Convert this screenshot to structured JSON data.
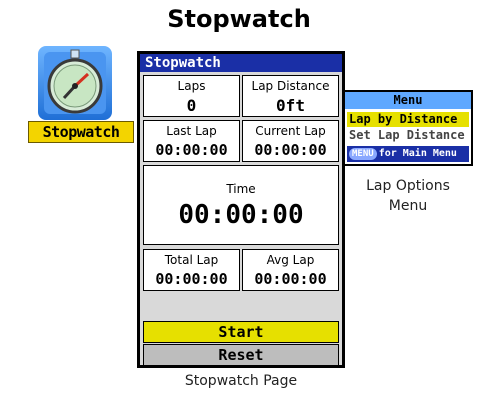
{
  "page_title": "Stopwatch",
  "app_icon": {
    "label": "Stopwatch"
  },
  "screen": {
    "title": "Stopwatch",
    "laps": {
      "label": "Laps",
      "value": "0"
    },
    "lap_distance": {
      "label": "Lap Distance",
      "value": "0ft"
    },
    "last_lap": {
      "label": "Last Lap",
      "value": "00:00:00"
    },
    "current_lap": {
      "label": "Current Lap",
      "value": "00:00:00"
    },
    "time": {
      "label": "Time",
      "value": "00:00:00"
    },
    "total_lap": {
      "label": "Total Lap",
      "value": "00:00:00"
    },
    "avg_lap": {
      "label": "Avg Lap",
      "value": "00:00:00"
    },
    "start_label": "Start",
    "reset_label": "Reset",
    "caption": "Stopwatch Page"
  },
  "menu": {
    "title": "Menu",
    "items": [
      "Lap by Distance",
      "Set Lap Distance"
    ],
    "footer_key": "MENU",
    "footer_text": "for Main Menu",
    "caption_line1": "Lap Options",
    "caption_line2": "Menu"
  },
  "colors": {
    "title_bar": "#1a2fa6",
    "start_button": "#e6e000",
    "reset_button": "#bdbdbd",
    "icon_label_bg": "#f3d400",
    "menu_highlight": "#e6e000"
  },
  "icons": [
    "stopwatch-icon"
  ]
}
